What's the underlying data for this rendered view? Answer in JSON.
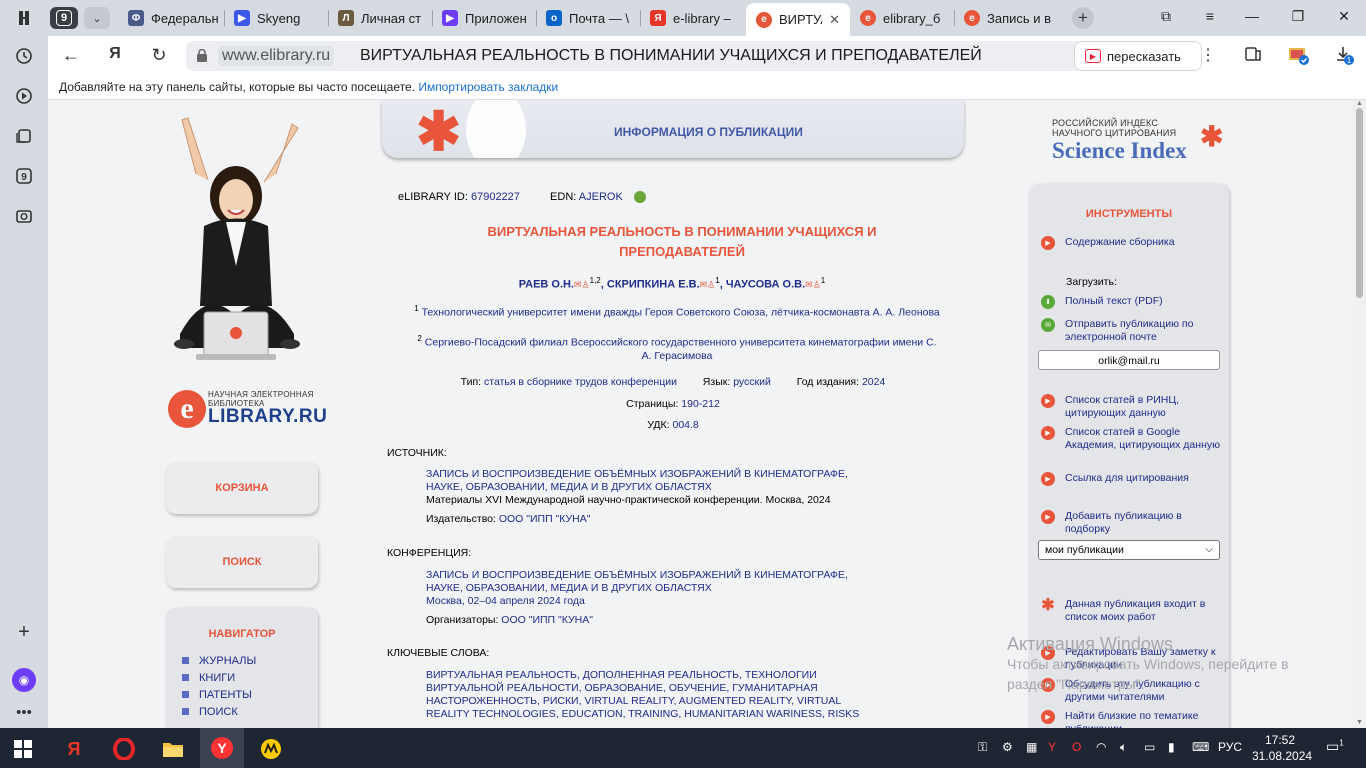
{
  "browser": {
    "tab_count": "9",
    "tabs": [
      {
        "title": "Федеральн",
        "fav_color": "#4a5a8a",
        "fav_char": "Ф"
      },
      {
        "title": "Skyeng",
        "fav_color": "#3b59e8",
        "fav_char": "▶"
      },
      {
        "title": "Личная ст",
        "fav_color": "#6b5b3e",
        "fav_char": "Л"
      },
      {
        "title": "Приложен",
        "fav_color": "#6d3df5",
        "fav_char": "▶"
      },
      {
        "title": "Почта — \\",
        "fav_color": "#0a63c7",
        "fav_char": "o"
      },
      {
        "title": "e-library –",
        "fav_color": "#e8352a",
        "fav_char": "Я"
      },
      {
        "title": "ВИРТУА",
        "fav_color": "#e8553a",
        "fav_char": "e",
        "active": true
      },
      {
        "title": "elibrary_б",
        "fav_color": "#e8553a",
        "fav_char": "e"
      },
      {
        "title": "Запись и в",
        "fav_color": "#e8553a",
        "fav_char": "e"
      }
    ],
    "url_domain": "www.elibrary.ru",
    "url_title": "ВИРТУАЛЬНАЯ РЕАЛЬНОСТЬ В ПОНИМАНИИ УЧАЩИХСЯ И ПРЕПОДАВАТЕЛЕЙ",
    "retell_label": "пересказать",
    "bookmarks_hint": "Добавляйте на эту панель сайты, которые вы часто посещаете.",
    "bookmarks_import": "Импортировать закладки",
    "downloads_badge": "1"
  },
  "left": {
    "logo_sub1": "НАУЧНАЯ ЭЛЕКТРОННАЯ",
    "logo_sub2": "БИБЛИОТЕКА",
    "logo_main": "LIBRARY.RU",
    "logo_letter": "e",
    "cart_label": "КОРЗИНА",
    "search_label": "ПОИСК",
    "nav_title": "НАВИГАТОР",
    "nav_items": [
      "ЖУРНАЛЫ",
      "КНИГИ",
      "ПАТЕНТЫ",
      "ПОИСК"
    ]
  },
  "publication": {
    "header": "ИНФОРМАЦИЯ О ПУБЛИКАЦИИ",
    "id_label": "eLIBRARY ID:",
    "id_value": "67902227",
    "edn_label": "EDN:",
    "edn_value": "AJEROK",
    "title_line1": "ВИРТУАЛЬНАЯ РЕАЛЬНОСТЬ В ПОНИМАНИИ УЧАЩИХСЯ И",
    "title_line2": "ПРЕПОДАВАТЕЛЕЙ",
    "authors": [
      {
        "name": "РАЕВ О.Н.",
        "sup": "1,2"
      },
      {
        "name": "СКРИПКИНА Е.В.",
        "sup": "1"
      },
      {
        "name": "ЧАУСОВА О.В.",
        "sup": "1"
      }
    ],
    "affil1_num": "1",
    "affil1": "Технологический университет имени дважды Героя Советского Союза, лётчика-космонавта А. А. Леонова",
    "affil2_num": "2",
    "affil2": "Сергиево-Посадский филиал Всероссийского государственного университета кинематографии имени С. А. Герасимова",
    "type_label": "Тип:",
    "type_value": "статья в сборнике трудов конференции",
    "lang_label": "Язык:",
    "lang_value": "русский",
    "year_label": "Год издания:",
    "year_value": "2024",
    "pages_label": "Страницы:",
    "pages_value": "190-212",
    "udk_label": "УДК:",
    "udk_value": "004.8",
    "source_label": "ИСТОЧНИК:",
    "source_title": "ЗАПИСЬ И ВОСПРОИЗВЕДЕНИЕ ОБЪЁМНЫХ ИЗОБРАЖЕНИЙ В КИНЕМАТОГРАФЕ, НАУКЕ, ОБРАЗОВАНИИ, МЕДИА И В ДРУГИХ ОБЛАСТЯХ",
    "source_desc": "Материалы XVI Международной научно-практической конференции. Москва, 2024",
    "publisher_label": "Издательство:",
    "publisher_value": "ООО \"ИПП \"КУНА\"",
    "conf_label": "КОНФЕРЕНЦИЯ:",
    "conf_title": "ЗАПИСЬ И ВОСПРОИЗВЕДЕНИЕ ОБЪЁМНЫХ ИЗОБРАЖЕНИЙ В КИНЕМАТОГРАФЕ, НАУКЕ, ОБРАЗОВАНИИ, МЕДИА И В ДРУГИХ ОБЛАСТЯХ",
    "conf_place": "Москва, 02–04 апреля 2024 года",
    "organizers_label": "Организаторы:",
    "organizers_value": "ООО \"ИПП \"КУНА\"",
    "keywords_label": "КЛЮЧЕВЫЕ СЛОВА:",
    "keywords": "ВИРТУАЛЬНАЯ РЕАЛЬНОСТЬ, ДОПОЛНЕННАЯ РЕАЛЬНОСТЬ, ТЕХНОЛОГИИ ВИРТУАЛЬНОЙ РЕАЛЬНОСТИ, ОБРАЗОВАНИЕ, ОБУЧЕНИЕ, ГУМАНИТАРНАЯ НАСТОРОЖЕННОСТЬ, РИСКИ, VIRTUAL REALITY, AUGMENTED REALITY, VIRTUAL REALITY TECHNOLOGIES, EDUCATION, TRAINING, HUMANITARIAN WARINESS, RISKS"
  },
  "right": {
    "scidx_l1": "РОССИЙСКИЙ ИНДЕКС",
    "scidx_l2": "НАУЧНОГО ЦИТИРОВАНИЯ",
    "scidx_big": "Science Index",
    "tools_title": "ИНСТРУМЕНТЫ",
    "contents": "Содержание сборника",
    "download_label": "Загрузить:",
    "fulltext": "Полный текст (PDF)",
    "send_email": "Отправить публикацию по электронной почте",
    "email_value": "orlik@mail.ru",
    "rinc_cites": "Список статей в РИНЦ, цитирующих данную",
    "google_cites": "Список статей в Google Академия, цитирующих данную",
    "cite_link": "Ссылка для цитирования",
    "add_collection": "Добавить публикацию в подборку",
    "collection_value": "мои публикации",
    "in_my_list": "Данная публикация входит в список моих работ",
    "edit_note": "Редактировать Вашу заметку к публикации",
    "discuss": "Обсудить эту публикацию с другими читателями",
    "similar": "Найти близкие по тематике публикации"
  },
  "watermark": {
    "line1": "Активация Windows",
    "line2": "Чтобы активировать Windows, перейдите в",
    "line3": "раздел \"Параметры\"."
  },
  "taskbar": {
    "lang": "РУС",
    "time": "17:52",
    "date": "31.08.2024",
    "notif_count": "1"
  }
}
